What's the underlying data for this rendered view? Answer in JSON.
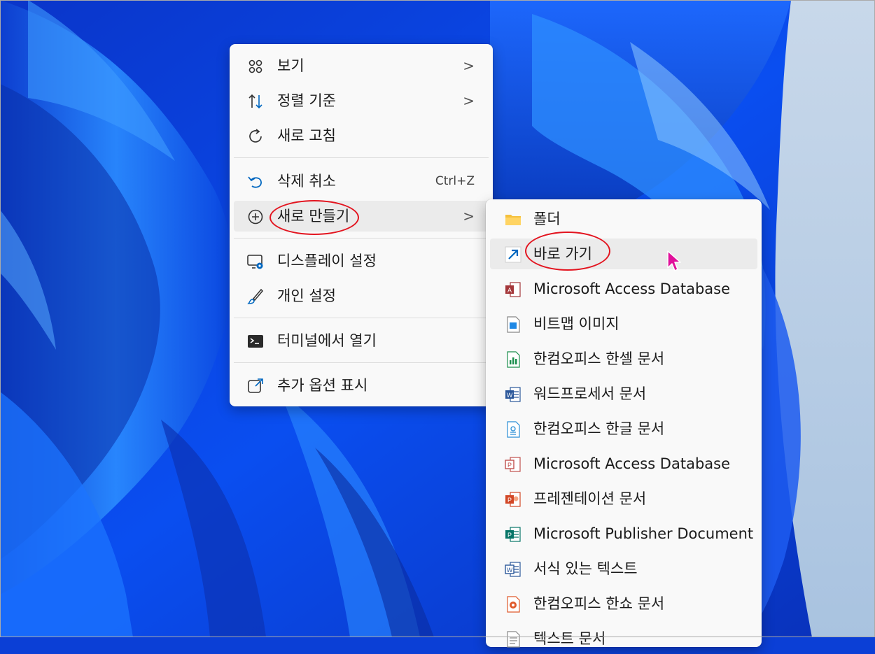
{
  "main_menu": {
    "items": [
      {
        "label": "보기",
        "icon": "grid-icon",
        "submenu": true
      },
      {
        "label": "정렬 기준",
        "icon": "sort-icon",
        "submenu": true
      },
      {
        "label": "새로 고침",
        "icon": "refresh-icon"
      },
      {
        "label": "삭제 취소",
        "icon": "undo-icon",
        "shortcut": "Ctrl+Z"
      },
      {
        "label": "새로 만들기",
        "icon": "plus-circle-icon",
        "submenu": true,
        "highlighted": true
      },
      {
        "label": "디스플레이 설정",
        "icon": "display-settings-icon"
      },
      {
        "label": "개인 설정",
        "icon": "brush-icon"
      },
      {
        "label": "터미널에서 열기",
        "icon": "terminal-icon"
      },
      {
        "label": "추가 옵션 표시",
        "icon": "open-external-icon"
      }
    ],
    "chevron": ">"
  },
  "new_submenu": {
    "items": [
      {
        "label": "폴더",
        "icon": "folder-icon"
      },
      {
        "label": "바로 가기",
        "icon": "shortcut-arrow-icon",
        "hovered": true
      },
      {
        "label": "Microsoft Access Database",
        "icon": "access-icon"
      },
      {
        "label": "비트맵 이미지",
        "icon": "bitmap-icon"
      },
      {
        "label": "한컴오피스 한셀 문서",
        "icon": "hancell-icon"
      },
      {
        "label": "워드프로세서 문서",
        "icon": "word-icon"
      },
      {
        "label": "한컴오피스 한글 문서",
        "icon": "hwp-icon"
      },
      {
        "label": "Microsoft Access Database",
        "icon": "access-icon-2"
      },
      {
        "label": "프레젠테이션 문서",
        "icon": "powerpoint-icon"
      },
      {
        "label": "Microsoft Publisher Document",
        "icon": "publisher-icon"
      },
      {
        "label": "서식 있는 텍스트",
        "icon": "rich-text-icon"
      },
      {
        "label": "한컴오피스 한쇼 문서",
        "icon": "hanshow-icon"
      },
      {
        "label": "텍스트 문서",
        "icon": "text-document-icon"
      }
    ]
  },
  "colors": {
    "accent": "#0067c0",
    "annotation_red": "#e3141f",
    "cursor": "#e0109a"
  }
}
